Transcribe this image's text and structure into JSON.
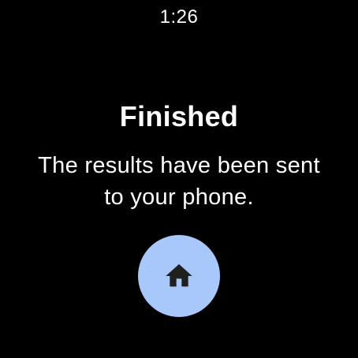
{
  "status_bar": {
    "time": "1:26"
  },
  "dialog": {
    "title": "Finished",
    "message": "The results have been sent to your phone."
  },
  "home_button": {
    "icon": "home-icon",
    "background_color": "#a8c7fa",
    "icon_color": "#1f1f1f"
  }
}
